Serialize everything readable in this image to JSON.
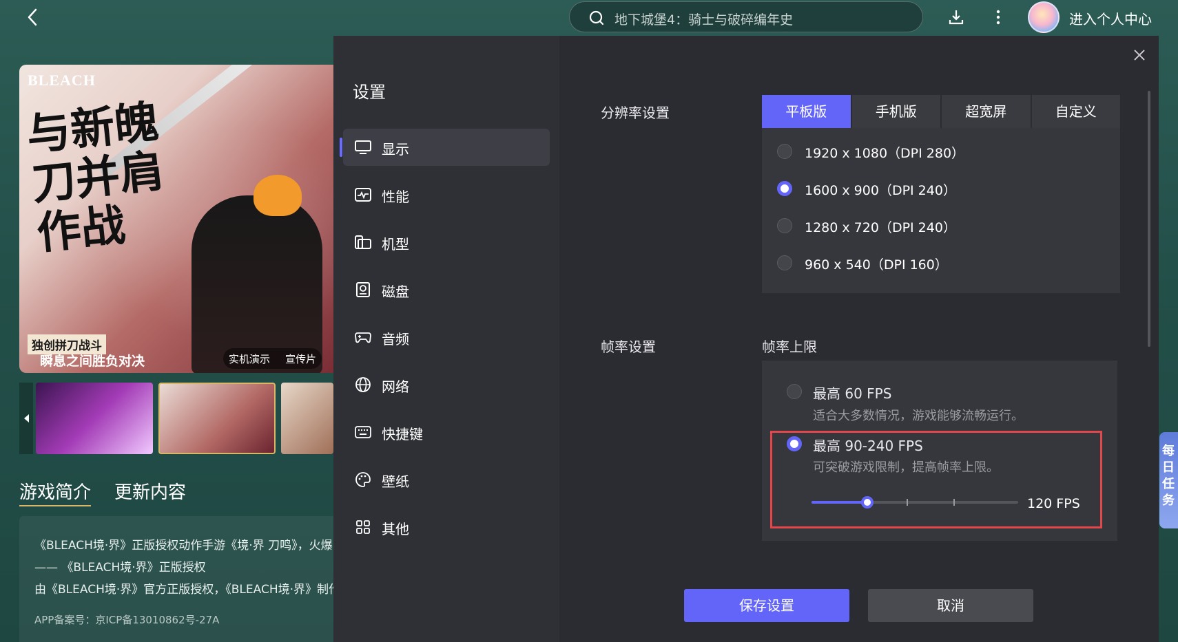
{
  "topbar": {
    "search_text": "地下城堡4：骑士与破碎编年史",
    "user_center": "进入个人中心"
  },
  "game": {
    "hero": {
      "brand": "BLEACH",
      "calligraphy": "与新魄刀并肩作战",
      "tag1": "独创拼刀战斗",
      "tag2": "瞬息之间胜负对决",
      "tab_demo": "实机演示",
      "tab_trailer": "宣传片"
    },
    "tabs": {
      "intro": "游戏简介",
      "update": "更新内容"
    },
    "intro_lines": [
      "《BLEACH境·界》正版授权动作手游《境·界 刀鸣》，火爆",
      "—— 《BLEACH境·界》正版授权",
      "由《BLEACH境·界》官方正版授权，《BLEACH境·界》制作"
    ],
    "icp": "APP备案号：京ICP备13010862号-27A",
    "right_strip": "每日任务"
  },
  "settings": {
    "title": "设置",
    "menu": [
      {
        "label": "显示",
        "icon": "monitor-icon"
      },
      {
        "label": "性能",
        "icon": "performance-icon"
      },
      {
        "label": "机型",
        "icon": "device-model-icon"
      },
      {
        "label": "磁盘",
        "icon": "disk-icon"
      },
      {
        "label": "音频",
        "icon": "gamepad-audio-icon"
      },
      {
        "label": "网络",
        "icon": "globe-icon"
      },
      {
        "label": "快捷键",
        "icon": "keyboard-icon"
      },
      {
        "label": "壁纸",
        "icon": "palette-icon"
      },
      {
        "label": "其他",
        "icon": "grid-icon"
      }
    ],
    "resolution": {
      "label": "分辨率设置",
      "tabs": [
        "平板版",
        "手机版",
        "超宽屏",
        "自定义"
      ],
      "active_tab": "平板版",
      "options": [
        "1920 x 1080（DPI 280）",
        "1600 x 900（DPI 240）",
        "1280 x 720（DPI 240）",
        "960 x 540（DPI 160）"
      ],
      "selected": "1600 x 900（DPI 240）"
    },
    "framerate": {
      "label": "帧率设置",
      "sub_label": "帧率上限",
      "option1_title": "最高 60 FPS",
      "option1_desc": "适合大多数情况，游戏能够流畅运行。",
      "option2_title": "最高 90-240 FPS",
      "option2_desc": "可突破游戏限制，提高帧率上限。",
      "slider_value": "120 FPS",
      "slider_fraction": 0.27,
      "selected_option": "option2"
    },
    "save_label": "保存设置",
    "cancel_label": "取消"
  },
  "colors": {
    "accent": "#6365f8",
    "highlight_border": "#e4474b",
    "dialog_bg": "#2b2c31"
  }
}
